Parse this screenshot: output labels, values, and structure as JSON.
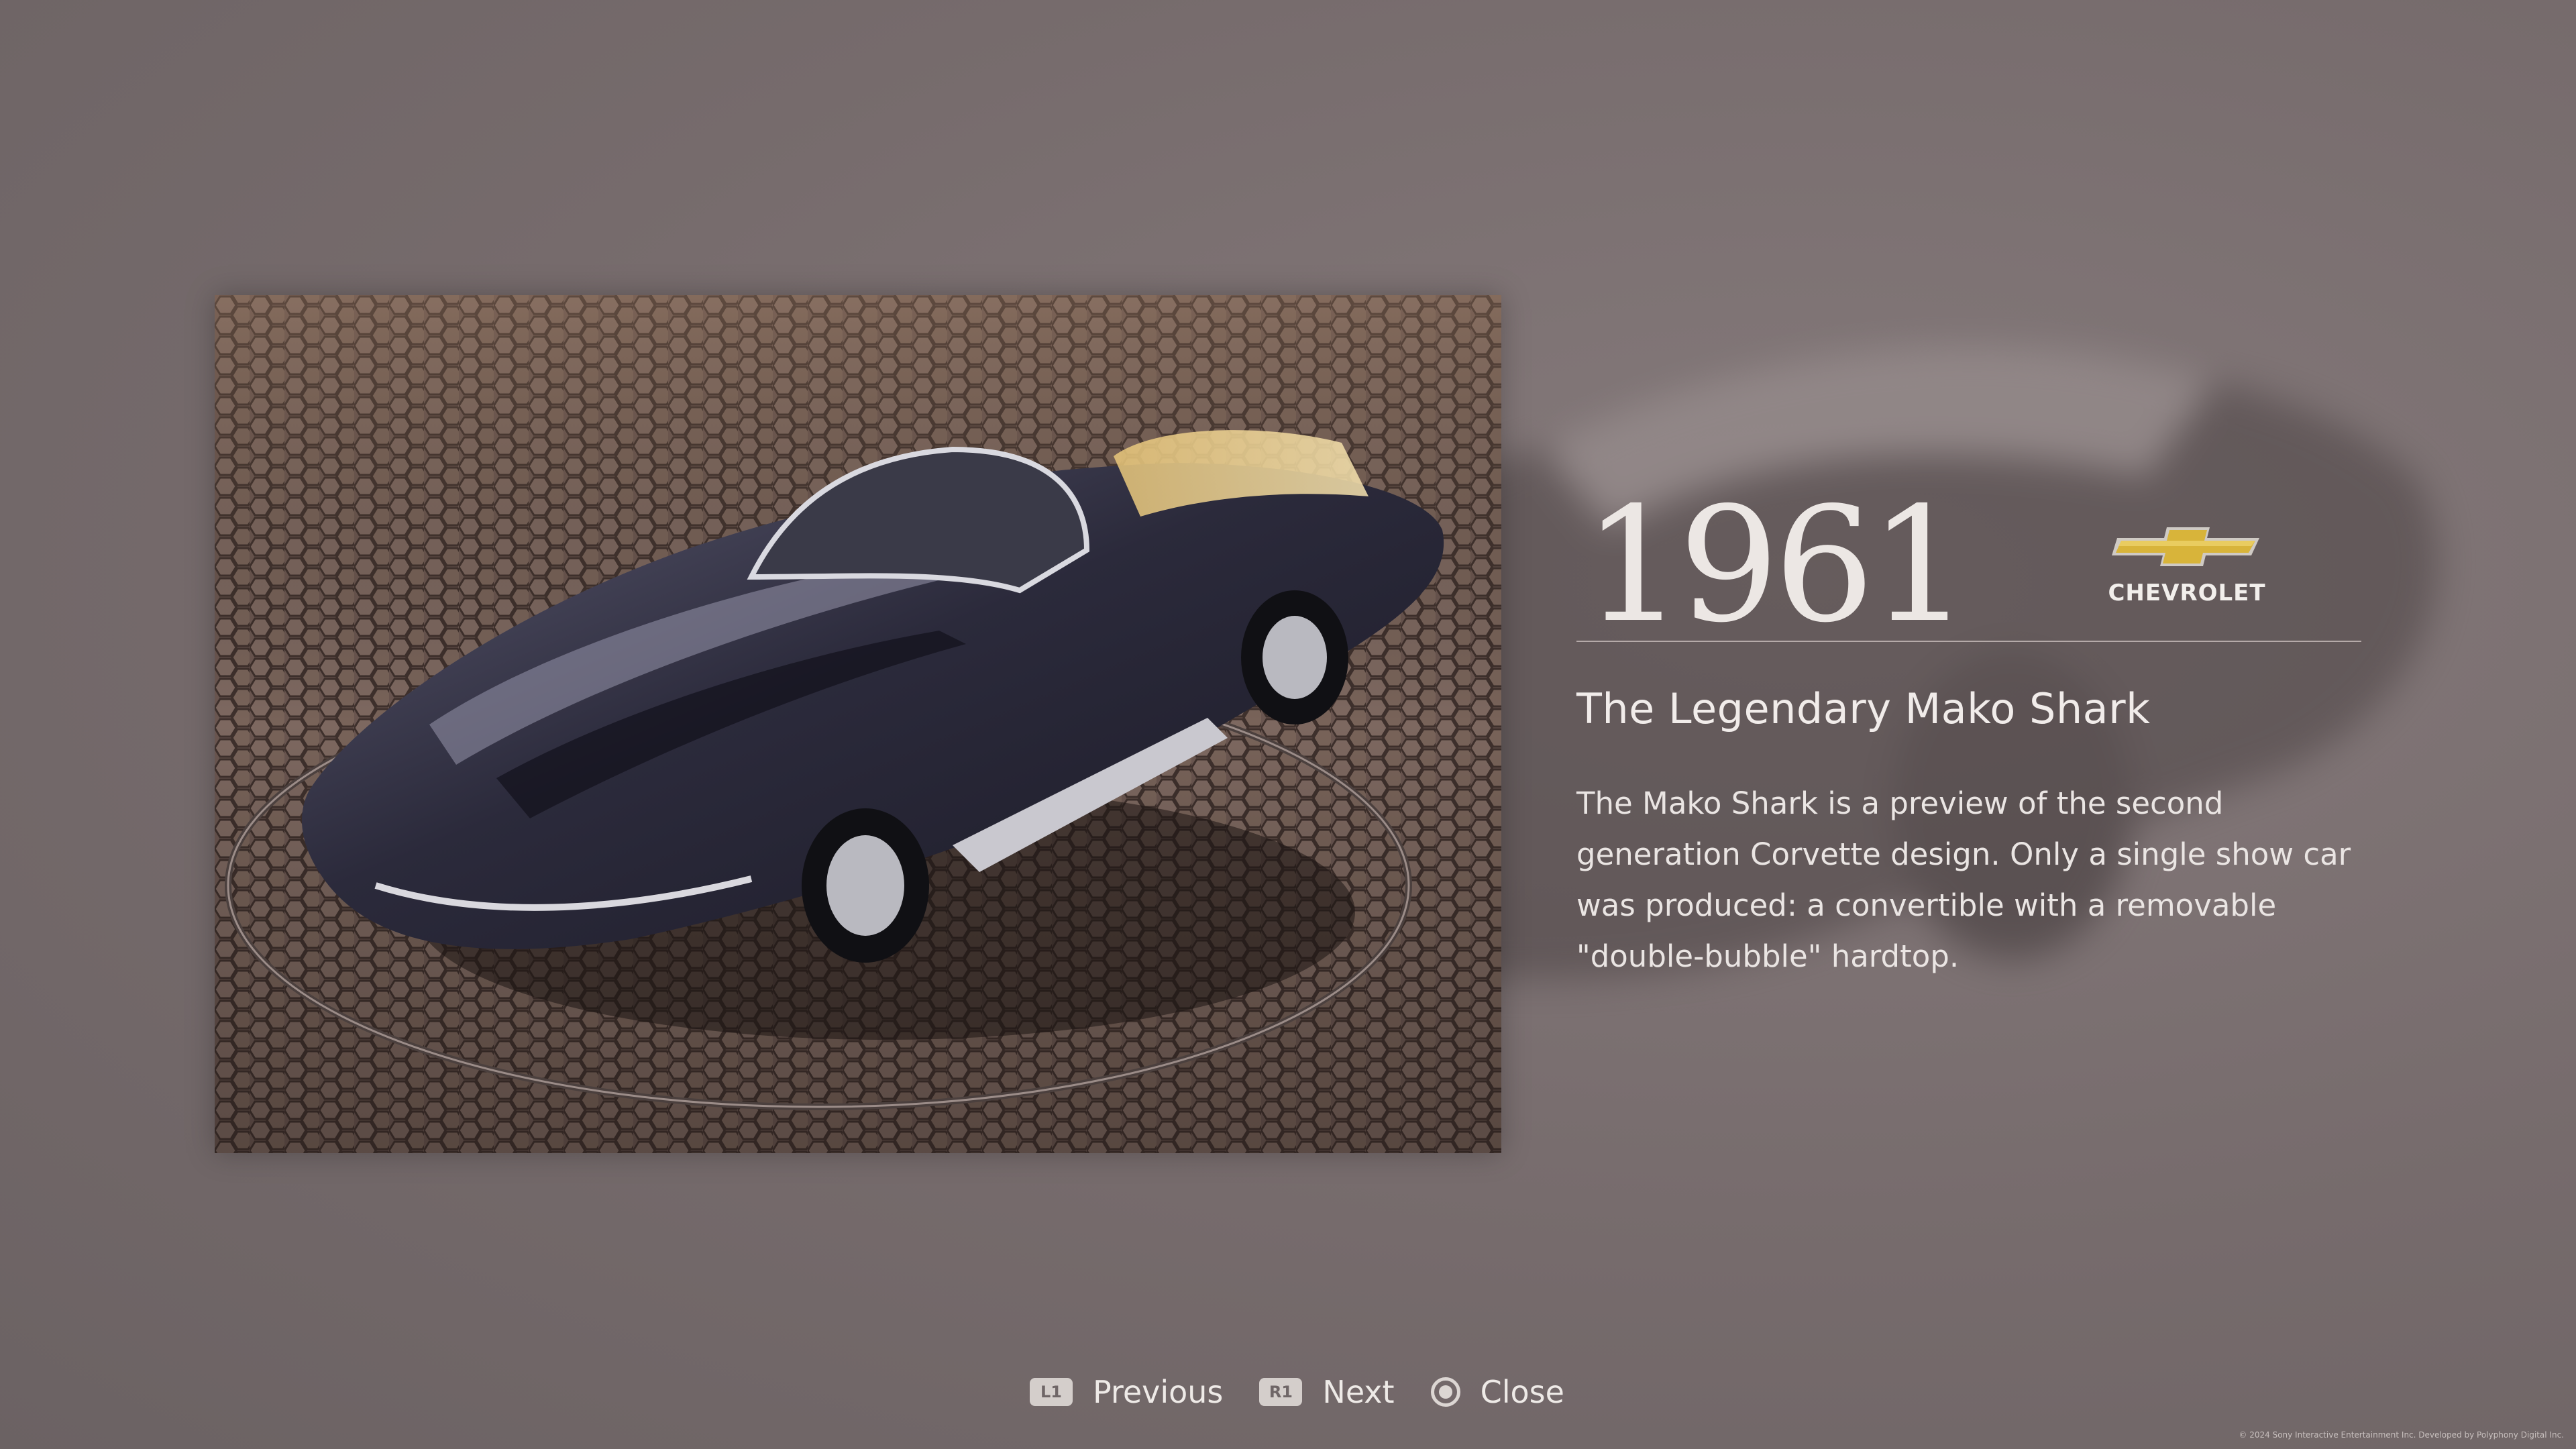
{
  "entry": {
    "year": "1961",
    "brand": "CHEVROLET",
    "title": "The Legendary Mako Shark",
    "description": "The Mako Shark is a preview of the second generation Corvette design. Only a single show car was produced: a convertible with a removable \"double-bubble\" hardtop.",
    "photo_subject": "Chevrolet Corvette Mako Shark show car on hexagonal cobblestone turntable"
  },
  "controls": [
    {
      "button": "L1",
      "label": "Previous"
    },
    {
      "button": "R1",
      "label": "Next"
    },
    {
      "button": "circle",
      "label": "Close"
    }
  ],
  "footer": {
    "copyright": "© 2024 Sony Interactive Entertainment Inc. Developed by Polyphony Digital Inc."
  },
  "colors": {
    "background": "#786d6e",
    "text": "#ece7e4",
    "bowtie_gold": "#d8b43a",
    "car_body": "#2c2a3c"
  },
  "icons": {
    "brand_logo": "chevrolet-bowtie-icon",
    "close_button": "circle-button-icon"
  }
}
